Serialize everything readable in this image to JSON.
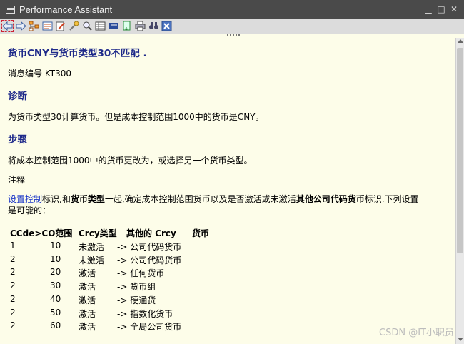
{
  "window": {
    "title": "Performance Assistant"
  },
  "toolbar_icons": [
    "back-arrow-icon",
    "forward-arrow-icon",
    "structure-icon",
    "tree-icon",
    "edit-icon",
    "tools-icon",
    "search-icon",
    "table-icon",
    "flag-icon",
    "document-icon",
    "print-icon",
    "binoculars-icon",
    "close-icon"
  ],
  "message": {
    "title": "货币CNY与货币类型30不匹配 .",
    "number_line": "消息编号 KT300",
    "diagnosis_heading": "诊断",
    "diagnosis_text": "为货币类型30计算货币。但是成本控制范围1000中的货币是CNY。",
    "steps_heading": "步骤",
    "steps_text": "将成本控制范围1000中的货币更改为，或选择另一个货币类型。",
    "note_label": "注释",
    "note_link": "设置控制",
    "note_t1": "标识,和",
    "note_b1": "货币类型",
    "note_t2": "一起,确定成本控制范围货币以及是否激活或未激活",
    "note_b2": "其他公司代码货币",
    "note_t3": "标识.下列设置",
    "note_line2": "是可能的："
  },
  "table": {
    "headers": [
      "CCde>CO范围",
      "Crcy类型",
      "其他的 Crcy",
      "货币"
    ],
    "rows": [
      [
        "1",
        "10",
        "未激活",
        "-> 公司代码货币"
      ],
      [
        "2",
        "10",
        "未激活",
        "-> 公司代码货币"
      ],
      [
        "2",
        "20",
        "激活",
        "-> 任何货币"
      ],
      [
        "2",
        "30",
        "激活",
        "-> 货币组"
      ],
      [
        "2",
        "40",
        "激活",
        "-> 硬通货"
      ],
      [
        "2",
        "50",
        "激活",
        "-> 指数化货币"
      ],
      [
        "2",
        "60",
        "激活",
        "-> 全局公司货币"
      ]
    ]
  },
  "watermark": "CSDN @IT小职员"
}
